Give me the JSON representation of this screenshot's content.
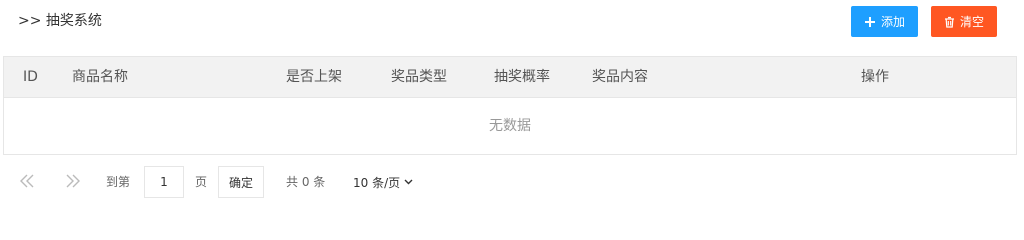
{
  "header": {
    "title": ">> 抽奖系统",
    "add_label": "添加",
    "clear_label": "清空"
  },
  "colors": {
    "add_button": "#1e9fff",
    "clear_button": "#ff5722",
    "table_header_bg": "#f2f2f2"
  },
  "table": {
    "columns": [
      "ID",
      "商品名称",
      "是否上架",
      "奖品类型",
      "抽奖概率",
      "奖品内容",
      "操作"
    ],
    "empty_text": "无数据"
  },
  "pagination": {
    "goto_prefix": "到第",
    "page_value": "1",
    "page_suffix": "页",
    "confirm_label": "确定",
    "total_text": "共 0 条",
    "page_size_label": "10 条/页"
  },
  "icons": {
    "first_page": "double-left-icon",
    "prev_page": "double-right-icon",
    "add": "plus-icon",
    "clear": "trash-icon",
    "page_size": "chevron-down-icon"
  }
}
